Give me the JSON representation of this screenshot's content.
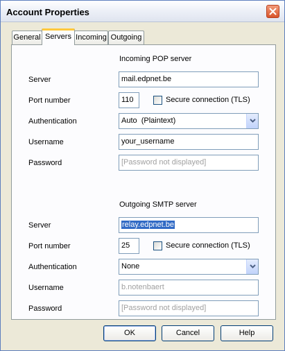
{
  "window": {
    "title": "Account Properties"
  },
  "tabs": [
    {
      "label": "General"
    },
    {
      "label": "Servers",
      "active": true
    },
    {
      "label": "Incoming"
    },
    {
      "label": "Outgoing"
    }
  ],
  "incoming": {
    "heading": "Incoming POP server",
    "server_label": "Server",
    "server_value": "mail.edpnet.be",
    "port_label": "Port number",
    "port_value": "110",
    "secure_label": "Secure connection (TLS)",
    "secure_checked": false,
    "auth_label": "Authentication",
    "auth_value": "Auto  (Plaintext)",
    "username_label": "Username",
    "username_value": "your_username",
    "password_label": "Password",
    "password_value": "[Password not displayed]"
  },
  "outgoing": {
    "heading": "Outgoing SMTP server",
    "server_label": "Server",
    "server_value": "relay.edpnet.be",
    "port_label": "Port number",
    "port_value": "25",
    "secure_label": "Secure connection (TLS)",
    "secure_checked": false,
    "auth_label": "Authentication",
    "auth_value": "None",
    "username_label": "Username",
    "username_value": "b.notenbaert",
    "password_label": "Password",
    "password_value": "[Password not displayed]"
  },
  "buttons": {
    "ok": "OK",
    "cancel": "Cancel",
    "help": "Help"
  },
  "colors": {
    "tab_highlight": "#ffc83c",
    "selection": "#316ac5",
    "field_border": "#7f9db9"
  },
  "icons": {
    "close": "close-icon",
    "dropdown": "chevron-down-icon"
  }
}
